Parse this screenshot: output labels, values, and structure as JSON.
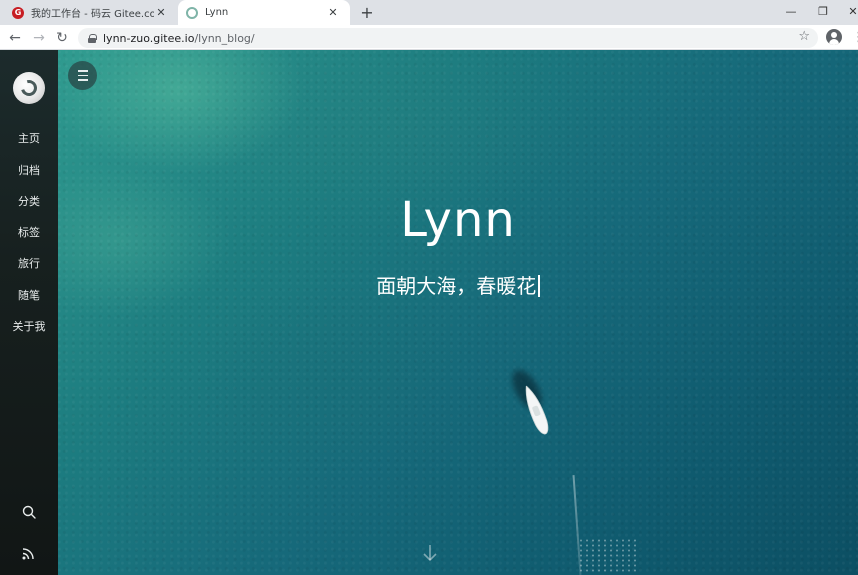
{
  "browser": {
    "tabs": [
      {
        "title": "我的工作台 - 码云 Gitee.com",
        "favicon": "gitee-icon",
        "favicon_letter": "G",
        "active": false
      },
      {
        "title": "Lynn",
        "favicon": "lynn-favicon-icon",
        "active": true
      }
    ],
    "close_glyph": "✕",
    "new_tab_glyph": "+",
    "window_controls": {
      "minimize": "—",
      "maximize": "❐",
      "close": "✕"
    },
    "nav": {
      "back": "←",
      "forward": "→",
      "reload": "↻"
    },
    "url": {
      "host": "lynn-zuo.gitee.io",
      "path": "/lynn_blog/"
    },
    "star_glyph": "☆",
    "menu_glyph": "⋮"
  },
  "sidebar": {
    "logo": "site-logo-icon",
    "items": [
      {
        "label": "主页"
      },
      {
        "label": "归档"
      },
      {
        "label": "分类"
      },
      {
        "label": "标签"
      },
      {
        "label": "旅行"
      },
      {
        "label": "随笔"
      },
      {
        "label": "关于我"
      }
    ],
    "bottom_icons": [
      "search-icon",
      "rss-icon"
    ]
  },
  "hero": {
    "title": "Lynn",
    "subtitle": "面朝大海，春暖花"
  },
  "colors": {
    "sidebar_bg": "#17201f",
    "hero_sea": "#16697a",
    "text": "#ffffff"
  }
}
